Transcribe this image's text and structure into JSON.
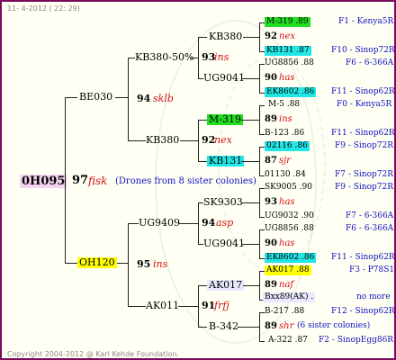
{
  "header": {
    "date": "11-  4-2012 ( 22: 29)"
  },
  "footer": {
    "copyright": "Copyright 2004-2012 @ Karl Kehde Foundation."
  },
  "root": {
    "id": "0H095",
    "year": "97",
    "name": "fisk",
    "note": "(Drones from 8 sister colonies)"
  },
  "gen1": [
    {
      "id": "BE030"
    },
    {
      "id": "OH120",
      "year": "95",
      "name": "ins"
    }
  ],
  "gen2": [
    {
      "id": "KB380-50%",
      "year": "94",
      "name": "sklb"
    },
    {
      "id": "KB380"
    },
    {
      "id": "UG9409",
      "year": "94",
      "name": "asp"
    },
    {
      "id": "AK011",
      "year": "91",
      "name": "frfj"
    }
  ],
  "gen3": [
    {
      "id": "KB380",
      "year": "93",
      "name": "ins"
    },
    {
      "id": "UG9041"
    },
    {
      "id": "M-319",
      "year": "92",
      "name": "nex"
    },
    {
      "id": "KB131"
    },
    {
      "id": "SK9303",
      "year": "94",
      "name": "asp"
    },
    {
      "id": "UG9041"
    },
    {
      "id": "AK017",
      "year": "91",
      "name": "frfj"
    },
    {
      "id": "B-342"
    }
  ],
  "gen4": [
    {
      "text": "M-319 .89",
      "line": "F1 - Kenya5R"
    },
    {
      "year": "92",
      "name": "nex"
    },
    {
      "text": "KB131 .87",
      "line": "F10 - Sinop72R"
    },
    {
      "text": "UG8856 .88",
      "line": "F6 - 6-366A"
    },
    {
      "year": "90",
      "name": "has"
    },
    {
      "text": "EK8602 .86",
      "line": "F11 - Sinop62R"
    },
    {
      "text": "M-5 .88",
      "line": "F0 - Kenya5R"
    },
    {
      "year": "89",
      "name": "ins"
    },
    {
      "text": "B-123 .86",
      "line": "F11 - Sinop62R"
    },
    {
      "text": "02116 .86",
      "line": "F9 - Sinop72R"
    },
    {
      "year": "87",
      "name": "sjr"
    },
    {
      "text": "01130 .84",
      "line": "F7 - Sinop72R"
    },
    {
      "text": "SK9005 .90",
      "line": "F9 - Sinop72R"
    },
    {
      "year": "93",
      "name": "has"
    },
    {
      "text": "UG9032 .90",
      "line": "F7 - 6-366A"
    },
    {
      "text": "UG8856 .88",
      "line": "F6 - 6-366A"
    },
    {
      "year": "90",
      "name": "has"
    },
    {
      "text": "EK8602 .86",
      "line": "F11 - Sinop62R"
    },
    {
      "text": "AK017 .88",
      "line": "F3 - P78S1"
    },
    {
      "year": "89",
      "name": "naf"
    },
    {
      "text": "Bxx89(AK) .",
      "line": "no more"
    },
    {
      "text": "B-217 .88",
      "line": "F12 - Sinop62R"
    },
    {
      "year": "89",
      "name": "shr",
      "note": "(6 sister colonies)"
    },
    {
      "text": "A-322 .87",
      "line": "F2 - SinopEgg86R"
    }
  ]
}
